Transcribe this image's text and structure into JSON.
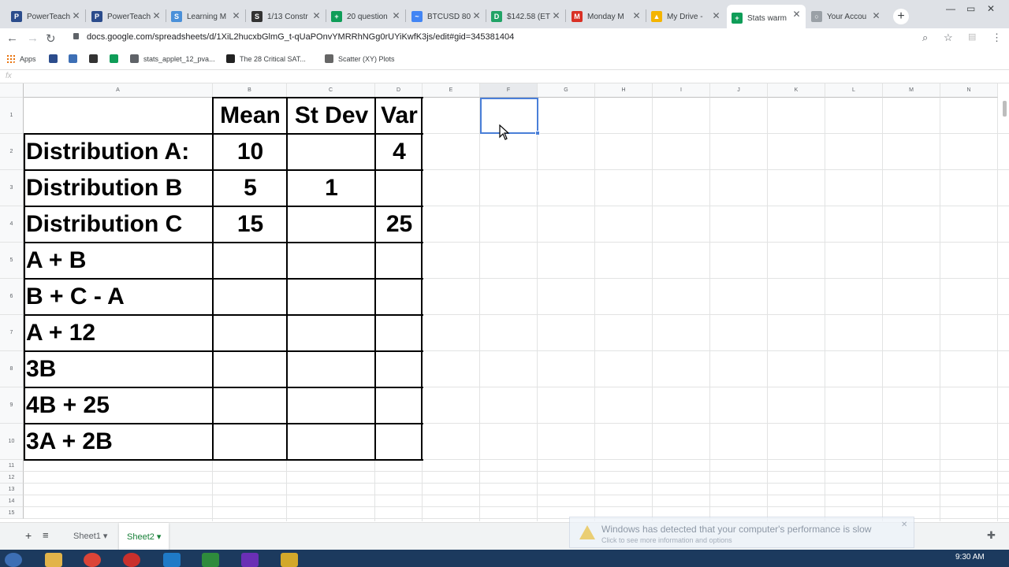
{
  "browser": {
    "tabs": [
      {
        "title": "PowerTeach",
        "icon_color": "#2b4c8c",
        "icon_text": "P"
      },
      {
        "title": "PowerTeach",
        "icon_color": "#2b4c8c",
        "icon_text": "P"
      },
      {
        "title": "Learning M",
        "icon_color": "#4a90d9",
        "icon_text": "S"
      },
      {
        "title": "1/13 Constr",
        "icon_color": "#333333",
        "icon_text": "S"
      },
      {
        "title": "20 question",
        "icon_color": "#0f9d58",
        "icon_text": "+"
      },
      {
        "title": "BTCUSD 80",
        "icon_color": "#4285f4",
        "icon_text": "~"
      },
      {
        "title": "$142.58 (ET",
        "icon_color": "#21a366",
        "icon_text": "D"
      },
      {
        "title": "Monday M",
        "icon_color": "#d93025",
        "icon_text": "M"
      },
      {
        "title": "My Drive -",
        "icon_color": "#f4b400",
        "icon_text": "▲"
      },
      {
        "title": "Stats warm",
        "icon_color": "#0f9d58",
        "icon_text": "+"
      },
      {
        "title": "Your Accou",
        "icon_color": "#9aa0a6",
        "icon_text": "○"
      }
    ],
    "active_tab_index": 9,
    "new_tab_label": "+",
    "url": "docs.google.com/spreadsheets/d/1XiL2hucxbGlmG_t-qUaPOnvYMRRhNGg0rUYiKwfK3js/edit#gid=345381404",
    "bookmarks": [
      {
        "label": "Apps",
        "icon": "apps-grid-icon"
      },
      {
        "label": "",
        "icon": "powerschool-icon"
      },
      {
        "label": "",
        "icon": "app-icon"
      },
      {
        "label": "",
        "icon": "schoology-icon"
      },
      {
        "label": "",
        "icon": "sheets-icon"
      },
      {
        "label": "stats_applet_12_pva...",
        "icon": "link-icon"
      },
      {
        "label": "The 28 Critical SAT...",
        "icon": "school-icon"
      },
      {
        "label": "Scatter (XY) Plots",
        "icon": "scatter-icon"
      }
    ]
  },
  "sheet": {
    "formula_label": "fx",
    "columns": [
      "A",
      "B",
      "C",
      "D",
      "E",
      "F",
      "G",
      "H",
      "I",
      "J",
      "K",
      "L",
      "M",
      "N"
    ],
    "selected_column": "F",
    "rows": [
      "1",
      "2",
      "3",
      "4",
      "5",
      "6",
      "7",
      "8",
      "9",
      "10",
      "11",
      "12",
      "13",
      "14",
      "15"
    ],
    "header": [
      "",
      "Mean",
      "St Dev",
      "Var"
    ],
    "table": [
      [
        "Distribution A:",
        "10",
        "",
        "4"
      ],
      [
        "Distribution B",
        "5",
        "1",
        ""
      ],
      [
        "Distribution C",
        "15",
        "",
        "25"
      ],
      [
        "A + B",
        "",
        "",
        ""
      ],
      [
        "B + C - A",
        "",
        "",
        ""
      ],
      [
        "A + 12",
        "",
        "",
        ""
      ],
      [
        "3B",
        "",
        "",
        ""
      ],
      [
        "4B + 25",
        "",
        "",
        ""
      ],
      [
        "3A + 2B",
        "",
        "",
        ""
      ]
    ],
    "selected_cell": "F1"
  },
  "sheets_bar": {
    "add_label": "+",
    "list_label": "≡",
    "tabs": [
      {
        "label": "Sheet1",
        "active": false
      },
      {
        "label": "Sheet2",
        "active": true
      }
    ]
  },
  "notification": {
    "title": "Windows has detected that your computer's performance is slow",
    "subtitle": "Click to see more information and options"
  },
  "taskbar": {
    "clock": "9:30 AM"
  }
}
